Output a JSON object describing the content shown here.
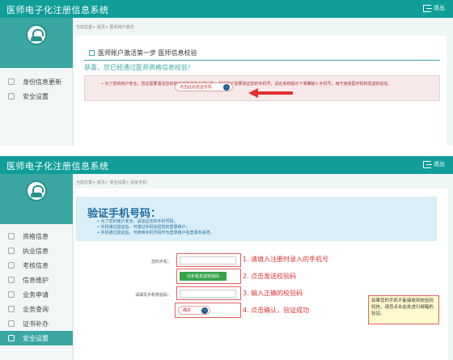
{
  "shot1": {
    "title": "医师电子化注册信息系统",
    "exit_label": "退出",
    "breadcrumb": "当前位置> 首页> 医师账户激活",
    "menu": [
      {
        "label": "身份信息更新",
        "icon": "id-card-icon"
      },
      {
        "label": "安全设置",
        "icon": "shield-icon"
      }
    ],
    "step_title": "医师账户激活第一步 医师信息校验",
    "congrats": "恭喜，您已经通过医师资格信息校验！",
    "notice": "• 为了您的帐户安全，您还需要激活您的账户才能使用全部功能，激活账户需要验证您的手机号，请在系统提示下准确输入手机号，用于接收医疗机构发送的信息。",
    "verify_button": "点击此处验证手机"
  },
  "shot2": {
    "title": "医师电子化注册信息系统",
    "exit_label": "退出",
    "breadcrumb": "当前位置> 首页> 安全设置> 验证手机",
    "menu": [
      {
        "label": "资格信息",
        "icon": "certificate-icon"
      },
      {
        "label": "执业信息",
        "icon": "practice-icon"
      },
      {
        "label": "考核信息",
        "icon": "exam-icon"
      },
      {
        "label": "信息维护",
        "icon": "edit-icon"
      },
      {
        "label": "业务申请",
        "icon": "apply-icon"
      },
      {
        "label": "业务查询",
        "icon": "query-icon"
      },
      {
        "label": "证书补办",
        "icon": "reissue-icon"
      },
      {
        "label": "安全设置",
        "icon": "shield-icon"
      }
    ],
    "page_title": "验证手机号码：",
    "bullets": [
      "• 为了您的账户安全，请验证您的手机号码；",
      "• 手机通过验证后，可通过手机找回您的登录账户；",
      "• 手机通过验证后，可使用手机号码作为登录用户名登录本系统。"
    ],
    "phone_label": "您的手机：",
    "send_button": "向手机发送校验码",
    "code_label": "请填写手机校验码：",
    "confirm_button": "确定",
    "steps": [
      "1. 请填入注册时录入的手机号",
      "2. 点击发送校验码",
      "3. 输入正确的校验码",
      "4. 点击确认，验证成功"
    ],
    "tip": "如果您的手机不能接收到校验码短信，请您点击此处进行邮箱的验证。"
  },
  "colors": {
    "header": "#0f9e9a",
    "accent": "#3aa7a3",
    "annotation": "#e03030"
  }
}
